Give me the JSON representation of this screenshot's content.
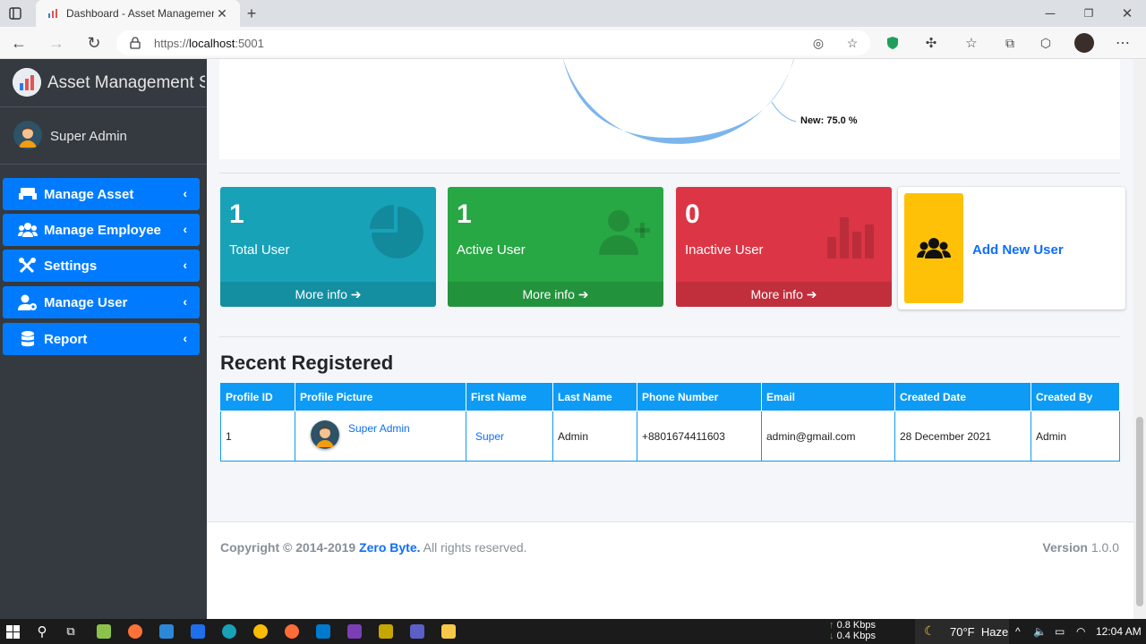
{
  "browser": {
    "tab_title": "Dashboard - Asset Management",
    "url_prefix": "https://",
    "url_host": "localhost",
    "url_port": ":5001"
  },
  "sidebar": {
    "brand": "Asset Management Sys",
    "user_name": "Super Admin",
    "items": [
      {
        "label": "Manage Asset",
        "icon": "people-carry-icon"
      },
      {
        "label": "Manage Employee",
        "icon": "users-icon"
      },
      {
        "label": "Settings",
        "icon": "tools-icon"
      },
      {
        "label": "Manage User",
        "icon": "user-cog-icon"
      },
      {
        "label": "Report",
        "icon": "database-icon"
      }
    ]
  },
  "pie": {
    "label": "New: 75.0 %",
    "color": "#7cb5ec"
  },
  "stats": [
    {
      "number": "1",
      "label": "Total User",
      "more": "More info",
      "color": "#17a2b8",
      "icon": "chart-pie-icon"
    },
    {
      "number": "1",
      "label": "Active User",
      "more": "More info",
      "color": "#28a745",
      "icon": "user-plus-icon"
    },
    {
      "number": "0",
      "label": "Inactive User",
      "more": "More info",
      "color": "#dc3545",
      "icon": "bar-chart-icon"
    }
  ],
  "add_user": {
    "label": "Add New User",
    "icon": "users-icon"
  },
  "recent": {
    "title": "Recent Registered",
    "columns": [
      "Profile ID",
      "Profile Picture",
      "First Name",
      "Last Name",
      "Phone Number",
      "Email",
      "Created Date",
      "Created By"
    ],
    "rows": [
      {
        "id": "1",
        "picture_name": "Super Admin",
        "first": "Super",
        "last": "Admin",
        "phone": "+8801674411603",
        "email": "admin@gmail.com",
        "created": "28 December 2021",
        "by": "Admin"
      }
    ]
  },
  "footer": {
    "copy_prefix": "Copyright © 2014-2019",
    "company": "Zero Byte.",
    "rights": "All rights reserved.",
    "version_label": "Version",
    "version": "1.0.0"
  },
  "taskbar": {
    "net_up": "0.8 Kbps",
    "net_down": "0.4 Kbps",
    "weather": "70°F  Haze",
    "time": "12:04 AM"
  }
}
